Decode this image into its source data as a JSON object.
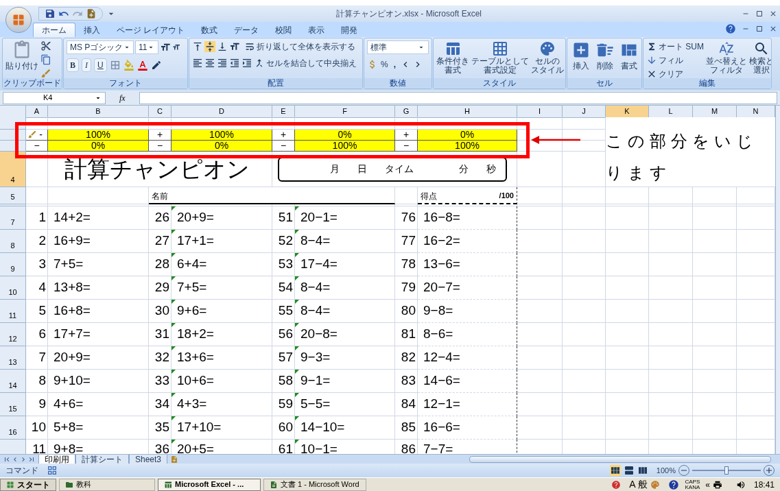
{
  "window": {
    "title": "計算チャンピオン.xlsx - Microsoft Excel"
  },
  "ribbon_tabs": [
    {
      "label": "ホーム",
      "selected": true
    },
    {
      "label": "挿入",
      "selected": false
    },
    {
      "label": "ページ レイアウト",
      "selected": false
    },
    {
      "label": "数式",
      "selected": false
    },
    {
      "label": "データ",
      "selected": false
    },
    {
      "label": "校閲",
      "selected": false
    },
    {
      "label": "表示",
      "selected": false
    },
    {
      "label": "開発",
      "selected": false
    }
  ],
  "ribbon": {
    "clipboard": {
      "label": "クリップボード",
      "paste": "貼り付け"
    },
    "font": {
      "label": "フォント",
      "name": "MS Pゴシック",
      "size": "11",
      "bold": "B",
      "italic": "I",
      "underline": "U"
    },
    "alignment": {
      "label": "配置",
      "wrap": "折り返して全体を表示する",
      "merge": "セルを結合して中央揃え"
    },
    "number": {
      "label": "数値",
      "format": "標準",
      "percent": "%",
      "comma": ","
    },
    "styles": {
      "label": "スタイル",
      "buttons": [
        [
          "条件付き",
          "書式"
        ],
        [
          "テーブルとして",
          "書式設定"
        ],
        [
          "セルの",
          "スタイル"
        ]
      ]
    },
    "cells": {
      "label": "セル",
      "buttons": [
        "挿入",
        "削除",
        "書式"
      ]
    },
    "editing": {
      "label": "編集",
      "autosum": "オート SUM",
      "fill": "フィル",
      "clear": "クリア",
      "sort": [
        "並べ替えと",
        "フィルタ"
      ],
      "find": [
        "検索と",
        "選択"
      ]
    }
  },
  "formula_bar": {
    "name_box": "K4",
    "fx": "fx"
  },
  "columns": [
    {
      "label": "A",
      "selected": false
    },
    {
      "label": "B",
      "selected": false
    },
    {
      "label": "C",
      "selected": false
    },
    {
      "label": "D",
      "selected": false
    },
    {
      "label": "E",
      "selected": false
    },
    {
      "label": "F",
      "selected": false
    },
    {
      "label": "G",
      "selected": false
    },
    {
      "label": "H",
      "selected": false
    },
    {
      "label": "I",
      "selected": false
    },
    {
      "label": "J",
      "selected": false
    },
    {
      "label": "K",
      "selected": true
    },
    {
      "label": "L",
      "selected": false
    },
    {
      "label": "M",
      "selected": false
    },
    {
      "label": "N",
      "selected": false
    }
  ],
  "control_rows": [
    {
      "cells": [
        {
          "kind": "sign",
          "text": "-"
        },
        {
          "kind": "percent",
          "text": "100%"
        },
        {
          "kind": "sign",
          "text": "+"
        },
        {
          "kind": "percent",
          "text": "100%"
        },
        {
          "kind": "sign",
          "text": "+"
        },
        {
          "kind": "percent",
          "text": "0%"
        },
        {
          "kind": "sign",
          "text": "+"
        },
        {
          "kind": "percent",
          "text": "0%"
        }
      ]
    },
    {
      "cells": [
        {
          "kind": "sign",
          "text": "−"
        },
        {
          "kind": "percent",
          "text": "0%"
        },
        {
          "kind": "sign",
          "text": "−"
        },
        {
          "kind": "percent",
          "text": "0%"
        },
        {
          "kind": "sign",
          "text": "−"
        },
        {
          "kind": "percent",
          "text": "100%"
        },
        {
          "kind": "sign",
          "text": "−"
        },
        {
          "kind": "percent",
          "text": "100%"
        }
      ]
    }
  ],
  "title_row": {
    "header": "4",
    "selected": true,
    "title": "計算チャンピオン",
    "time_box": [
      "月",
      "日",
      "タイム",
      "分",
      "秒"
    ]
  },
  "name_row": {
    "header": "5",
    "selected": false,
    "name_label": "名前",
    "score_label": "得点",
    "score_max": "/100"
  },
  "problem_rows": [
    {
      "header": "7",
      "items": [
        {
          "no": "1",
          "expr": "14+2="
        },
        {
          "no": "26",
          "expr": "20+9="
        },
        {
          "no": "51",
          "expr": "20−1="
        },
        {
          "no": "76",
          "expr": "16−8="
        }
      ]
    },
    {
      "header": "8",
      "items": [
        {
          "no": "2",
          "expr": "16+9="
        },
        {
          "no": "27",
          "expr": "17+1="
        },
        {
          "no": "52",
          "expr": "8−4="
        },
        {
          "no": "77",
          "expr": "16−2="
        }
      ]
    },
    {
      "header": "9",
      "items": [
        {
          "no": "3",
          "expr": "7+5="
        },
        {
          "no": "28",
          "expr": "6+4="
        },
        {
          "no": "53",
          "expr": "17−4="
        },
        {
          "no": "78",
          "expr": "13−6="
        }
      ]
    },
    {
      "header": "10",
      "items": [
        {
          "no": "4",
          "expr": "13+8="
        },
        {
          "no": "29",
          "expr": "7+5="
        },
        {
          "no": "54",
          "expr": "8−4="
        },
        {
          "no": "79",
          "expr": "20−7="
        }
      ]
    },
    {
      "header": "11",
      "items": [
        {
          "no": "5",
          "expr": "16+8="
        },
        {
          "no": "30",
          "expr": "9+6="
        },
        {
          "no": "55",
          "expr": "8−4="
        },
        {
          "no": "80",
          "expr": "9−8="
        }
      ]
    },
    {
      "header": "12",
      "items": [
        {
          "no": "6",
          "expr": "17+7="
        },
        {
          "no": "31",
          "expr": "18+2="
        },
        {
          "no": "56",
          "expr": "20−8="
        },
        {
          "no": "81",
          "expr": "8−6="
        }
      ]
    },
    {
      "header": "13",
      "items": [
        {
          "no": "7",
          "expr": "20+9="
        },
        {
          "no": "32",
          "expr": "13+6="
        },
        {
          "no": "57",
          "expr": "9−3="
        },
        {
          "no": "82",
          "expr": "12−4="
        }
      ]
    },
    {
      "header": "14",
      "items": [
        {
          "no": "8",
          "expr": "9+10="
        },
        {
          "no": "33",
          "expr": "10+6="
        },
        {
          "no": "58",
          "expr": "9−1="
        },
        {
          "no": "83",
          "expr": "14−6="
        }
      ]
    },
    {
      "header": "15",
      "items": [
        {
          "no": "9",
          "expr": "4+6="
        },
        {
          "no": "34",
          "expr": "4+3="
        },
        {
          "no": "59",
          "expr": "5−5="
        },
        {
          "no": "84",
          "expr": "12−1="
        }
      ]
    },
    {
      "header": "16",
      "items": [
        {
          "no": "10",
          "expr": "5+8="
        },
        {
          "no": "35",
          "expr": "17+10="
        },
        {
          "no": "60",
          "expr": "14−10="
        },
        {
          "no": "85",
          "expr": "16−6="
        }
      ]
    },
    {
      "header": "",
      "items": [
        {
          "no": "11",
          "expr": "9+8="
        },
        {
          "no": "36",
          "expr": "20+5="
        },
        {
          "no": "61",
          "expr": "10−1="
        },
        {
          "no": "86",
          "expr": "7−7="
        }
      ]
    }
  ],
  "annotation": {
    "text": "この部分をいじります"
  },
  "sheet_tabs": [
    {
      "label": "印刷用",
      "selected": true
    },
    {
      "label": "計算シート",
      "selected": false
    },
    {
      "label": "Sheet3",
      "selected": false
    }
  ],
  "status_bar": {
    "mode": "コマンド",
    "zoom": "100%",
    "zoom_slider": {
      "level": 0.5
    }
  },
  "taskbar": {
    "start": "スタート",
    "tasks": [
      {
        "label": "教科",
        "selected": false
      },
      {
        "label": "Microsoft Excel - ...",
        "selected": true
      },
      {
        "label": "文書 1 - Microsoft Word",
        "selected": false
      }
    ],
    "tray": {
      "ime_mode": "A",
      "ime_dict": "般",
      "caps": "CAPS",
      "kana": "KANA",
      "expand": "«",
      "clock": "18:41"
    }
  }
}
